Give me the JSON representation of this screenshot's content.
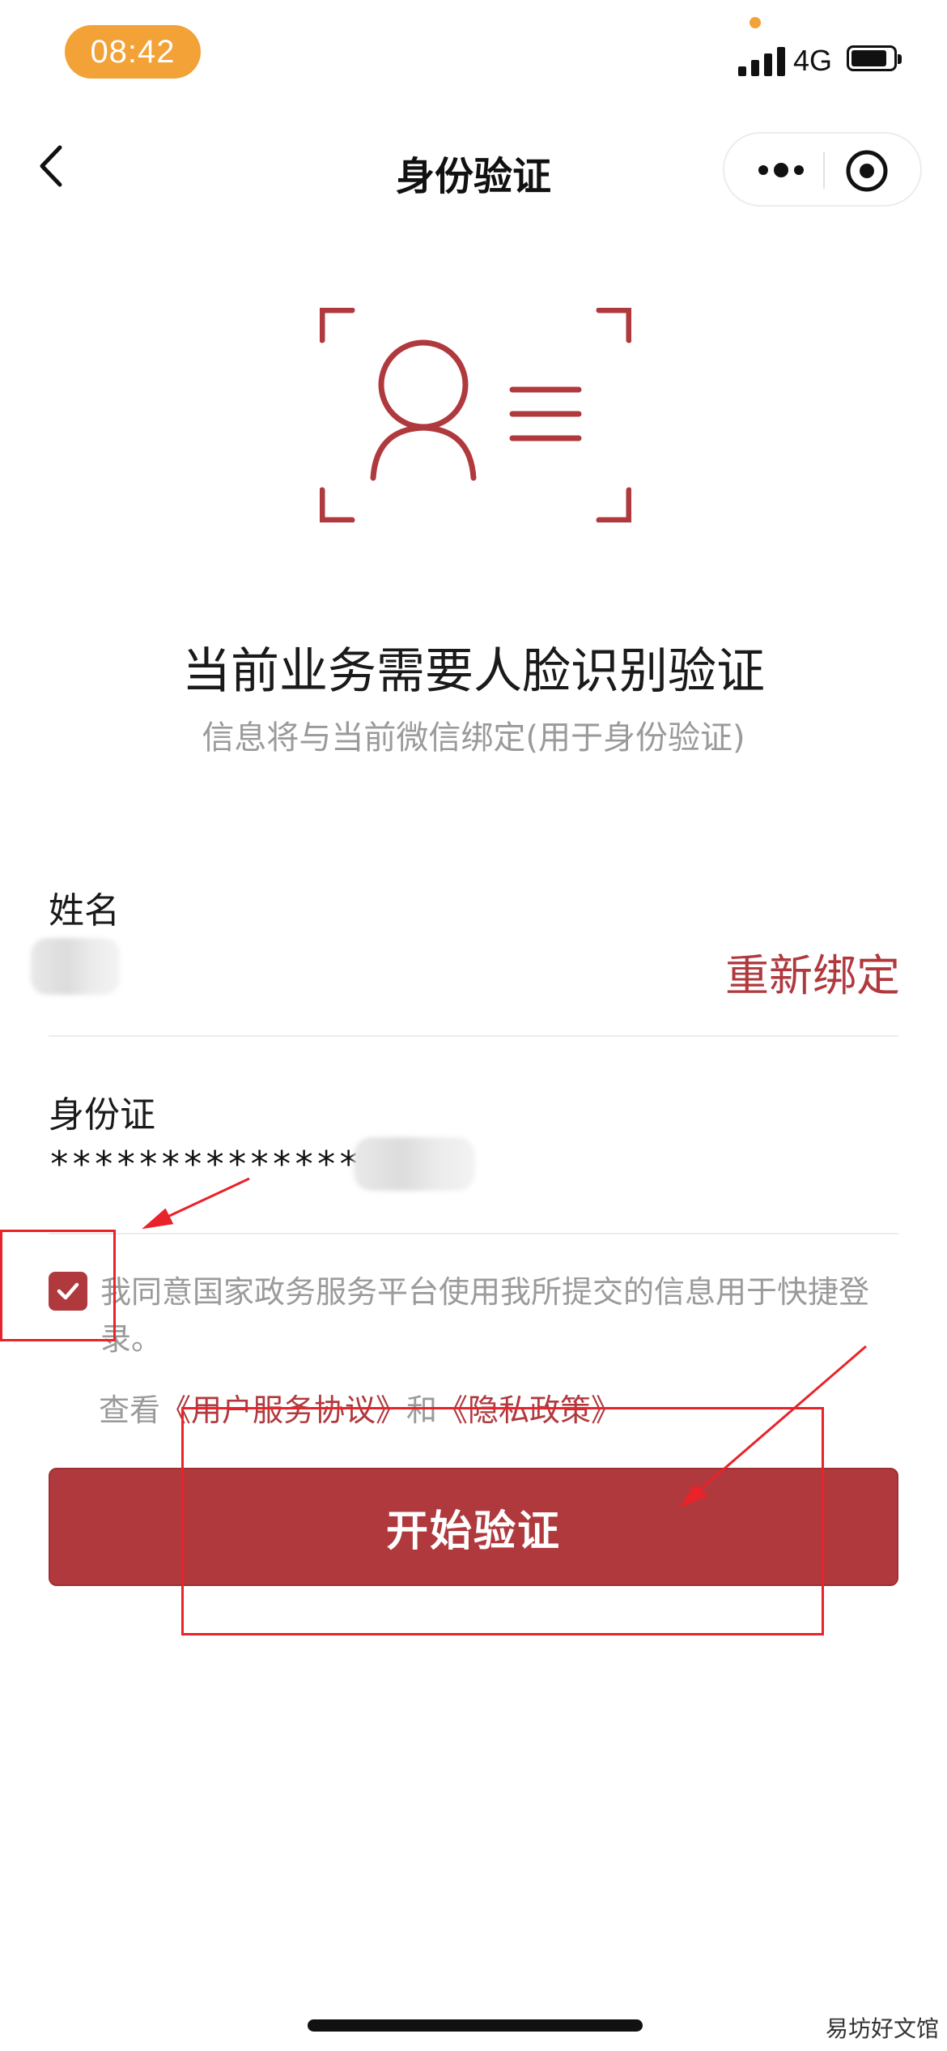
{
  "status_bar": {
    "time": "08:42",
    "network": "4G"
  },
  "nav": {
    "title": "身份验证",
    "icons": [
      "back-chevron-icon",
      "more-dots-icon",
      "target-circle-icon"
    ]
  },
  "hero": {
    "icon": "face-recognition-icon",
    "heading": "当前业务需要人脸识别验证",
    "subheading": "信息将与当前微信绑定(用于身份验证)"
  },
  "form": {
    "name_label": "姓名",
    "rebind_label": "重新绑定",
    "id_label": "身份证",
    "id_value_masked": "**************"
  },
  "consent": {
    "checked": true,
    "text": "我同意国家政务服务平台使用我所提交的信息用于快捷登录。",
    "view_prefix": "查看",
    "user_agreement": "《用户服务协议》",
    "conjunction": "和",
    "privacy_policy": "《隐私政策》"
  },
  "primary_button": "开始验证",
  "watermark": "易坊好文馆",
  "colors": {
    "accent": "#b0393e",
    "status_pill": "#f2a236",
    "annotation": "#e8232a",
    "muted_text": "#9a9a9a"
  }
}
